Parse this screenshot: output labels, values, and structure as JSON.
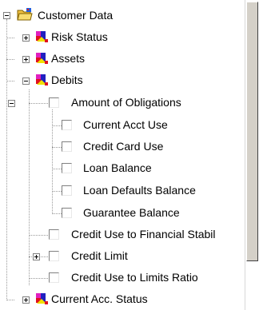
{
  "tree": {
    "root": {
      "label": "Customer Data",
      "icon": "folder-icon"
    },
    "items": [
      {
        "label": "Risk Status",
        "icon": "data-category-icon",
        "expander": "plus"
      },
      {
        "label": "Assets",
        "icon": "data-category-icon",
        "expander": "plus"
      },
      {
        "label": "Debits",
        "icon": "data-category-icon",
        "expander": "minus"
      },
      {
        "label": "Amount of Obligations",
        "icon": "checkbox",
        "expander": "minus"
      },
      {
        "label": "Current Acct Use",
        "icon": "checkbox"
      },
      {
        "label": "Credit Card Use",
        "icon": "checkbox"
      },
      {
        "label": "Loan Balance",
        "icon": "checkbox"
      },
      {
        "label": "Loan Defaults Balance",
        "icon": "checkbox"
      },
      {
        "label": "Guarantee Balance",
        "icon": "checkbox"
      },
      {
        "label": "Credit Use to Financial Stabil",
        "icon": "checkbox"
      },
      {
        "label": "Credit Limit",
        "icon": "checkbox",
        "expander": "plus"
      },
      {
        "label": "Credit Use to Limits Ratio",
        "icon": "checkbox"
      },
      {
        "label": "Current Acc. Status",
        "icon": "data-category-icon",
        "expander": "plus"
      }
    ]
  },
  "colors": {
    "folder": "#f0c040",
    "category_red": "#e01020",
    "category_blue": "#2020c0",
    "category_magenta": "#e020c0",
    "category_yellow": "#f0e000",
    "scrollbar_thumb": "#d4d0c8"
  }
}
